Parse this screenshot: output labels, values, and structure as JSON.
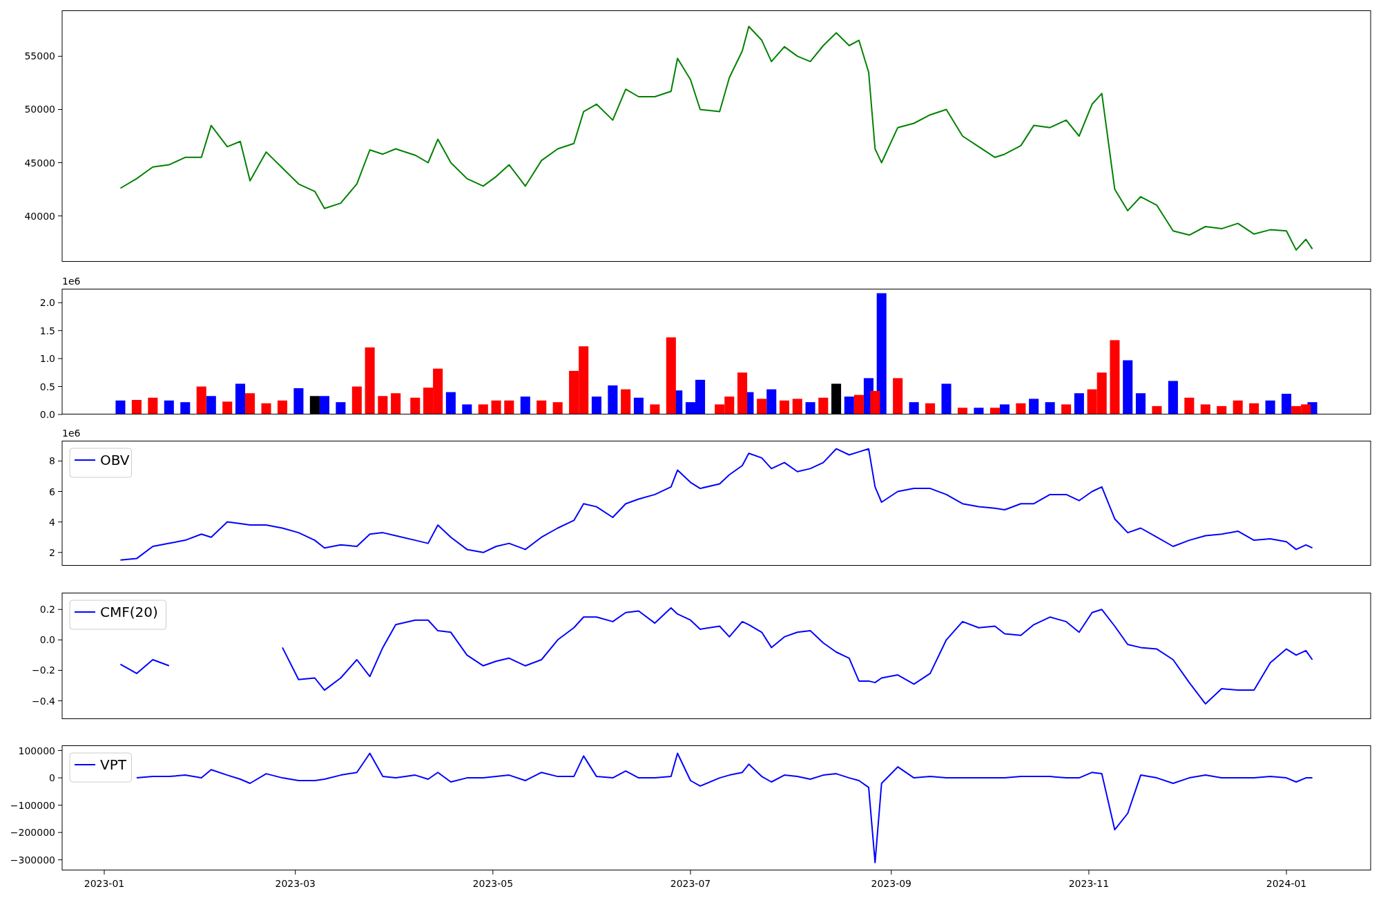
{
  "panels": [
    {
      "chart_data": {
        "type": "line",
        "x": [
          "2023-01-06",
          "2023-01-11",
          "2023-01-16",
          "2023-01-21",
          "2023-01-26",
          "2023-01-31",
          "2023-02-03",
          "2023-02-08",
          "2023-02-12",
          "2023-02-15",
          "2023-02-20",
          "2023-02-25",
          "2023-03-02",
          "2023-03-07",
          "2023-03-10",
          "2023-03-15",
          "2023-03-20",
          "2023-03-24",
          "2023-03-28",
          "2023-04-01",
          "2023-04-07",
          "2023-04-11",
          "2023-04-14",
          "2023-04-18",
          "2023-04-23",
          "2023-04-28",
          "2023-05-02",
          "2023-05-06",
          "2023-05-11",
          "2023-05-16",
          "2023-05-21",
          "2023-05-26",
          "2023-05-29",
          "2023-06-02",
          "2023-06-07",
          "2023-06-11",
          "2023-06-15",
          "2023-06-20",
          "2023-06-25",
          "2023-06-27",
          "2023-07-01",
          "2023-07-04",
          "2023-07-10",
          "2023-07-13",
          "2023-07-17",
          "2023-07-19",
          "2023-07-23",
          "2023-07-26",
          "2023-07-30",
          "2023-08-03",
          "2023-08-07",
          "2023-08-11",
          "2023-08-15",
          "2023-08-19",
          "2023-08-22",
          "2023-08-25",
          "2023-08-27",
          "2023-08-29",
          "2023-09-03",
          "2023-09-08",
          "2023-09-13",
          "2023-09-18",
          "2023-09-23",
          "2023-09-28",
          "2023-10-03",
          "2023-10-06",
          "2023-10-11",
          "2023-10-15",
          "2023-10-20",
          "2023-10-25",
          "2023-10-29",
          "2023-11-02",
          "2023-11-05",
          "2023-11-09",
          "2023-11-13",
          "2023-11-17",
          "2023-11-22",
          "2023-11-27",
          "2023-12-02",
          "2023-12-07",
          "2023-12-12",
          "2023-12-17",
          "2023-12-22",
          "2023-12-27",
          "2024-01-01",
          "2024-01-04",
          "2024-01-07",
          "2024-01-09"
        ],
        "xlim": [
          "2022-12-19",
          "2024-01-27"
        ],
        "ylim": [
          35690,
          59310
        ],
        "yticks": [
          40000,
          45000,
          50000,
          55000
        ],
        "series": [
          {
            "color": "#008000",
            "values": [
              42600,
              43500,
              44600,
              44800,
              45500,
              45500,
              48500,
              46500,
              47000,
              43300,
              46000,
              44500,
              43000,
              42300,
              40700,
              41200,
              43000,
              46200,
              45800,
              46300,
              45700,
              45000,
              47200,
              45000,
              43500,
              42800,
              43700,
              44800,
              42800,
              45200,
              46300,
              46800,
              49800,
              50500,
              49000,
              51900,
              51200,
              51200,
              51700,
              54800,
              52800,
              50000,
              49800,
              53000,
              55500,
              57800,
              56500,
              54500,
              55900,
              55000,
              54500,
              56000,
              57200,
              56000,
              56500,
              53500,
              46300,
              45000,
              48300,
              48700,
              49500,
              50000,
              47500,
              46500,
              45500,
              45800,
              46600,
              48500,
              48300,
              49000,
              47500,
              50500,
              51500,
              42500,
              40500,
              41800,
              41000,
              38600,
              38200,
              39000,
              38800,
              39300,
              38300,
              38700,
              38600,
              36800,
              37800,
              36900
            ]
          }
        ]
      }
    },
    {
      "scale_label": "1e6",
      "chart_data": {
        "type": "bar",
        "x": [
          "2023-01-06",
          "2023-01-11",
          "2023-01-16",
          "2023-01-21",
          "2023-01-26",
          "2023-01-31",
          "2023-02-03",
          "2023-02-08",
          "2023-02-12",
          "2023-02-15",
          "2023-02-20",
          "2023-02-25",
          "2023-03-02",
          "2023-03-07",
          "2023-03-10",
          "2023-03-15",
          "2023-03-20",
          "2023-03-24",
          "2023-03-28",
          "2023-04-01",
          "2023-04-07",
          "2023-04-11",
          "2023-04-14",
          "2023-04-18",
          "2023-04-23",
          "2023-04-28",
          "2023-05-02",
          "2023-05-06",
          "2023-05-11",
          "2023-05-16",
          "2023-05-21",
          "2023-05-26",
          "2023-05-29",
          "2023-06-02",
          "2023-06-07",
          "2023-06-11",
          "2023-06-15",
          "2023-06-20",
          "2023-06-25",
          "2023-06-27",
          "2023-07-01",
          "2023-07-04",
          "2023-07-10",
          "2023-07-13",
          "2023-07-17",
          "2023-07-19",
          "2023-07-23",
          "2023-07-26",
          "2023-07-30",
          "2023-08-03",
          "2023-08-07",
          "2023-08-11",
          "2023-08-15",
          "2023-08-19",
          "2023-08-22",
          "2023-08-25",
          "2023-08-27",
          "2023-08-29",
          "2023-09-03",
          "2023-09-08",
          "2023-09-13",
          "2023-09-18",
          "2023-09-23",
          "2023-09-28",
          "2023-10-03",
          "2023-10-06",
          "2023-10-11",
          "2023-10-15",
          "2023-10-20",
          "2023-10-25",
          "2023-10-29",
          "2023-11-02",
          "2023-11-05",
          "2023-11-09",
          "2023-11-13",
          "2023-11-17",
          "2023-11-22",
          "2023-11-27",
          "2023-12-02",
          "2023-12-07",
          "2023-12-12",
          "2023-12-17",
          "2023-12-22",
          "2023-12-27",
          "2024-01-01",
          "2024-01-04",
          "2024-01-07",
          "2024-01-09"
        ],
        "xlim": [
          "2022-12-19",
          "2024-01-27"
        ],
        "ylim": [
          0,
          2.25
        ],
        "yticks": [
          {
            "value": 0,
            "label": "0.0"
          },
          {
            "value": 0.5,
            "label": "0.5"
          },
          {
            "value": 1,
            "label": "1.0"
          },
          {
            "value": 1.5,
            "label": "1.5"
          },
          {
            "value": 2,
            "label": "2.0"
          }
        ],
        "series": [
          {
            "color": "#0000ff",
            "values": [
              0.25,
              null,
              null,
              0.25,
              0.22,
              null,
              0.33,
              null,
              0.55,
              null,
              null,
              null,
              0.47,
              null,
              0.33,
              0.22,
              null,
              null,
              null,
              null,
              null,
              null,
              null,
              0.4,
              0.18,
              null,
              null,
              null,
              0.32,
              null,
              null,
              null,
              null,
              0.32,
              0.52,
              null,
              0.3,
              null,
              null,
              0.43,
              0.22,
              0.62,
              null,
              null,
              null,
              0.4,
              null,
              0.45,
              null,
              null,
              0.22,
              null,
              null,
              0.32,
              null,
              0.65,
              null,
              2.17,
              null,
              0.22,
              null,
              0.55,
              null,
              0.12,
              null,
              0.18,
              null,
              0.28,
              0.22,
              null,
              0.38,
              null,
              null,
              null,
              0.97,
              0.38,
              null,
              0.6,
              null,
              null,
              null,
              null,
              null,
              0.25,
              0.37,
              null,
              null,
              0.22
            ]
          },
          {
            "color": "#ff0000",
            "values": [
              null,
              0.26,
              0.3,
              null,
              null,
              0.5,
              null,
              0.23,
              null,
              0.38,
              0.2,
              0.25,
              null,
              null,
              null,
              null,
              0.5,
              1.2,
              0.33,
              0.38,
              0.3,
              0.48,
              0.82,
              null,
              null,
              0.18,
              0.25,
              0.25,
              null,
              0.25,
              0.22,
              0.78,
              1.22,
              null,
              null,
              0.45,
              null,
              0.18,
              1.38,
              null,
              null,
              null,
              0.18,
              0.32,
              0.75,
              null,
              0.28,
              null,
              0.25,
              0.28,
              null,
              0.3,
              null,
              null,
              0.35,
              null,
              0.42,
              null,
              0.65,
              null,
              0.2,
              null,
              0.12,
              null,
              0.12,
              null,
              0.2,
              null,
              null,
              0.18,
              null,
              0.45,
              0.75,
              1.33,
              null,
              null,
              0.15,
              null,
              0.3,
              0.18,
              0.15,
              0.25,
              0.2,
              null,
              null,
              0.15,
              0.18,
              null
            ]
          },
          {
            "color": "#000000",
            "values": [
              null,
              null,
              null,
              null,
              null,
              null,
              null,
              null,
              null,
              null,
              null,
              null,
              null,
              0.33,
              null,
              null,
              null,
              null,
              null,
              null,
              null,
              null,
              null,
              null,
              null,
              null,
              null,
              null,
              null,
              null,
              null,
              null,
              null,
              null,
              null,
              null,
              null,
              null,
              null,
              null,
              null,
              null,
              null,
              null,
              null,
              null,
              null,
              null,
              null,
              null,
              null,
              null,
              0.55,
              null,
              null,
              null,
              null,
              null,
              null,
              null,
              null,
              null,
              null,
              null,
              null,
              null,
              null,
              null,
              null,
              null,
              null,
              null,
              null,
              null,
              null,
              null,
              null,
              null,
              null,
              null,
              null,
              null,
              null,
              null,
              null,
              null,
              null,
              null
            ]
          }
        ]
      }
    },
    {
      "scale_label": "1e6",
      "chart_data": {
        "type": "line",
        "x": [
          "2023-01-06",
          "2023-01-11",
          "2023-01-16",
          "2023-01-21",
          "2023-01-26",
          "2023-01-31",
          "2023-02-03",
          "2023-02-08",
          "2023-02-12",
          "2023-02-15",
          "2023-02-20",
          "2023-02-25",
          "2023-03-02",
          "2023-03-07",
          "2023-03-10",
          "2023-03-15",
          "2023-03-20",
          "2023-03-24",
          "2023-03-28",
          "2023-04-01",
          "2023-04-07",
          "2023-04-11",
          "2023-04-14",
          "2023-04-18",
          "2023-04-23",
          "2023-04-28",
          "2023-05-02",
          "2023-05-06",
          "2023-05-11",
          "2023-05-16",
          "2023-05-21",
          "2023-05-26",
          "2023-05-29",
          "2023-06-02",
          "2023-06-07",
          "2023-06-11",
          "2023-06-15",
          "2023-06-20",
          "2023-06-25",
          "2023-06-27",
          "2023-07-01",
          "2023-07-04",
          "2023-07-10",
          "2023-07-13",
          "2023-07-17",
          "2023-07-19",
          "2023-07-23",
          "2023-07-26",
          "2023-07-30",
          "2023-08-03",
          "2023-08-07",
          "2023-08-11",
          "2023-08-15",
          "2023-08-19",
          "2023-08-22",
          "2023-08-25",
          "2023-08-27",
          "2023-08-29",
          "2023-09-03",
          "2023-09-08",
          "2023-09-13",
          "2023-09-18",
          "2023-09-23",
          "2023-09-28",
          "2023-10-03",
          "2023-10-06",
          "2023-10-11",
          "2023-10-15",
          "2023-10-20",
          "2023-10-25",
          "2023-10-29",
          "2023-11-02",
          "2023-11-05",
          "2023-11-09",
          "2023-11-13",
          "2023-11-17",
          "2023-11-22",
          "2023-11-27",
          "2023-12-02",
          "2023-12-07",
          "2023-12-12",
          "2023-12-17",
          "2023-12-22",
          "2023-12-27",
          "2024-01-01",
          "2024-01-04",
          "2024-01-07",
          "2024-01-09"
        ],
        "xlim": [
          "2022-12-19",
          "2024-01-27"
        ],
        "ylim": [
          1.13,
          9.33
        ],
        "yticks": [
          2,
          4,
          6,
          8
        ],
        "series": [
          {
            "name": "OBV",
            "color": "#0000ff",
            "values": [
              1.5,
              1.6,
              2.4,
              2.6,
              2.8,
              3.2,
              3.0,
              4.0,
              3.9,
              3.8,
              3.8,
              3.6,
              3.3,
              2.8,
              2.3,
              2.5,
              2.4,
              3.2,
              3.3,
              3.1,
              2.8,
              2.6,
              3.8,
              3.0,
              2.2,
              2.0,
              2.4,
              2.6,
              2.2,
              3.0,
              3.6,
              4.1,
              5.2,
              5.0,
              4.3,
              5.2,
              5.5,
              5.8,
              6.3,
              7.4,
              6.6,
              6.2,
              6.5,
              7.1,
              7.7,
              8.5,
              8.2,
              7.5,
              7.9,
              7.3,
              7.5,
              7.9,
              8.8,
              8.4,
              8.6,
              8.8,
              6.3,
              5.3,
              6.0,
              6.2,
              6.2,
              5.8,
              5.2,
              5.0,
              4.9,
              4.8,
              5.2,
              5.2,
              5.8,
              5.8,
              5.4,
              6.0,
              6.3,
              4.2,
              3.3,
              3.6,
              3.0,
              2.4,
              2.8,
              3.1,
              3.2,
              3.4,
              2.8,
              2.9,
              2.7,
              2.2,
              2.5,
              2.3
            ]
          }
        ]
      }
    },
    {
      "chart_data": {
        "type": "line",
        "x": [
          "2023-01-06",
          "2023-01-11",
          "2023-01-16",
          "2023-01-21",
          "2023-01-26",
          "2023-01-31",
          "2023-02-03",
          "2023-02-08",
          "2023-02-12",
          "2023-02-15",
          "2023-02-20",
          "2023-02-25",
          "2023-03-02",
          "2023-03-07",
          "2023-03-10",
          "2023-03-15",
          "2023-03-20",
          "2023-03-24",
          "2023-03-28",
          "2023-04-01",
          "2023-04-07",
          "2023-04-11",
          "2023-04-14",
          "2023-04-18",
          "2023-04-23",
          "2023-04-28",
          "2023-05-02",
          "2023-05-06",
          "2023-05-11",
          "2023-05-16",
          "2023-05-21",
          "2023-05-26",
          "2023-05-29",
          "2023-06-02",
          "2023-06-07",
          "2023-06-11",
          "2023-06-15",
          "2023-06-20",
          "2023-06-25",
          "2023-06-27",
          "2023-07-01",
          "2023-07-04",
          "2023-07-10",
          "2023-07-13",
          "2023-07-17",
          "2023-07-19",
          "2023-07-23",
          "2023-07-26",
          "2023-07-30",
          "2023-08-03",
          "2023-08-07",
          "2023-08-11",
          "2023-08-15",
          "2023-08-19",
          "2023-08-22",
          "2023-08-25",
          "2023-08-27",
          "2023-08-29",
          "2023-09-03",
          "2023-09-08",
          "2023-09-13",
          "2023-09-18",
          "2023-09-23",
          "2023-09-28",
          "2023-10-03",
          "2023-10-06",
          "2023-10-11",
          "2023-10-15",
          "2023-10-20",
          "2023-10-25",
          "2023-10-29",
          "2023-11-02",
          "2023-11-05",
          "2023-11-09",
          "2023-11-13",
          "2023-11-17",
          "2023-11-22",
          "2023-11-27",
          "2023-12-02",
          "2023-12-07",
          "2023-12-12",
          "2023-12-17",
          "2023-12-22",
          "2023-12-27",
          "2024-01-01",
          "2024-01-04",
          "2024-01-07",
          "2024-01-09"
        ],
        "xlim": [
          "2022-12-19",
          "2024-01-27"
        ],
        "ylim": [
          -0.52,
          0.31
        ],
        "yticks": [
          {
            "value": 0.2,
            "label": "0.2"
          },
          {
            "value": 0,
            "label": "0.0"
          },
          {
            "value": -0.2,
            "label": "−0.2"
          },
          {
            "value": -0.4,
            "label": "−0.4"
          }
        ],
        "series": [
          {
            "name": "CMF(20)",
            "color": "#0000ff",
            "values": [
              -0.16,
              -0.22,
              -0.13,
              -0.17,
              null,
              null,
              null,
              null,
              null,
              null,
              null,
              -0.05,
              -0.26,
              -0.25,
              -0.33,
              -0.25,
              -0.13,
              -0.24,
              -0.05,
              0.1,
              0.13,
              0.13,
              0.06,
              0.05,
              -0.1,
              -0.17,
              -0.14,
              -0.12,
              -0.17,
              -0.13,
              0,
              0.08,
              0.15,
              0.15,
              0.12,
              0.18,
              0.19,
              0.11,
              0.21,
              0.17,
              0.13,
              0.07,
              0.09,
              0.02,
              0.12,
              0.1,
              0.05,
              -0.05,
              0.02,
              0.05,
              0.06,
              -0.02,
              -0.08,
              -0.12,
              -0.27,
              -0.27,
              -0.28,
              -0.25,
              -0.23,
              -0.29,
              -0.22,
              0,
              0.12,
              0.08,
              0.09,
              0.04,
              0.03,
              0.1,
              0.15,
              0.12,
              0.05,
              0.18,
              0.2,
              0.09,
              -0.03,
              -0.05,
              -0.06,
              -0.13,
              -0.28,
              -0.42,
              -0.32,
              -0.33,
              -0.33,
              -0.15,
              -0.06,
              -0.1,
              -0.07,
              -0.13
            ]
          }
        ]
      }
    },
    {
      "chart_data": {
        "type": "line",
        "x": [
          "2023-01-11",
          "2023-01-16",
          "2023-01-21",
          "2023-01-26",
          "2023-01-31",
          "2023-02-03",
          "2023-02-08",
          "2023-02-12",
          "2023-02-15",
          "2023-02-20",
          "2023-02-25",
          "2023-03-02",
          "2023-03-07",
          "2023-03-10",
          "2023-03-15",
          "2023-03-20",
          "2023-03-24",
          "2023-03-28",
          "2023-04-01",
          "2023-04-07",
          "2023-04-11",
          "2023-04-14",
          "2023-04-18",
          "2023-04-23",
          "2023-04-28",
          "2023-05-02",
          "2023-05-06",
          "2023-05-11",
          "2023-05-16",
          "2023-05-21",
          "2023-05-26",
          "2023-05-29",
          "2023-06-02",
          "2023-06-07",
          "2023-06-11",
          "2023-06-15",
          "2023-06-20",
          "2023-06-25",
          "2023-06-27",
          "2023-07-01",
          "2023-07-04",
          "2023-07-10",
          "2023-07-13",
          "2023-07-17",
          "2023-07-19",
          "2023-07-23",
          "2023-07-26",
          "2023-07-30",
          "2023-08-03",
          "2023-08-07",
          "2023-08-11",
          "2023-08-15",
          "2023-08-19",
          "2023-08-22",
          "2023-08-25",
          "2023-08-27",
          "2023-08-29",
          "2023-09-03",
          "2023-09-08",
          "2023-09-13",
          "2023-09-18",
          "2023-09-23",
          "2023-09-28",
          "2023-10-03",
          "2023-10-06",
          "2023-10-11",
          "2023-10-15",
          "2023-10-20",
          "2023-10-25",
          "2023-10-29",
          "2023-11-02",
          "2023-11-05",
          "2023-11-09",
          "2023-11-13",
          "2023-11-17",
          "2023-11-22",
          "2023-11-27",
          "2023-12-02",
          "2023-12-07",
          "2023-12-12",
          "2023-12-17",
          "2023-12-22",
          "2023-12-27",
          "2024-01-01",
          "2024-01-04",
          "2024-01-07",
          "2024-01-09"
        ],
        "xlim": [
          "2022-12-19",
          "2024-01-27"
        ],
        "ylim": [
          -338700,
          119000
        ],
        "xticks": [
          {
            "value": "2023-01-01",
            "label": "2023-01"
          },
          {
            "value": "2023-03-01",
            "label": "2023-03"
          },
          {
            "value": "2023-05-01",
            "label": "2023-05"
          },
          {
            "value": "2023-07-01",
            "label": "2023-07"
          },
          {
            "value": "2023-09-01",
            "label": "2023-09"
          },
          {
            "value": "2023-11-01",
            "label": "2023-11"
          },
          {
            "value": "2024-01-01",
            "label": "2024-01"
          }
        ],
        "yticks": [
          {
            "value": 100000,
            "label": "100000"
          },
          {
            "value": 0,
            "label": "0"
          },
          {
            "value": -100000,
            "label": "−100000"
          },
          {
            "value": -200000,
            "label": "−200000"
          },
          {
            "value": -300000,
            "label": "−300000"
          }
        ],
        "series": [
          {
            "name": "VPT",
            "color": "#0000ff",
            "values": [
              0,
              5000,
              5000,
              10000,
              0,
              30000,
              10000,
              -5000,
              -20000,
              15000,
              0,
              -10000,
              -10000,
              -5000,
              10000,
              20000,
              90000,
              5000,
              0,
              10000,
              -5000,
              20000,
              -15000,
              0,
              0,
              5000,
              10000,
              -10000,
              20000,
              5000,
              5000,
              80000,
              5000,
              0,
              25000,
              0,
              0,
              5000,
              90000,
              -10000,
              -30000,
              0,
              10000,
              20000,
              50000,
              5000,
              -15000,
              10000,
              5000,
              -5000,
              10000,
              15000,
              0,
              -10000,
              -35000,
              -310000,
              -20000,
              40000,
              0,
              5000,
              0,
              0,
              0,
              0,
              0,
              5000,
              5000,
              5000,
              0,
              0,
              20000,
              15000,
              -190000,
              -130000,
              10000,
              0,
              -20000,
              0,
              10000,
              0,
              0,
              0,
              5000,
              0,
              -15000,
              0,
              0
            ]
          }
        ]
      }
    }
  ]
}
